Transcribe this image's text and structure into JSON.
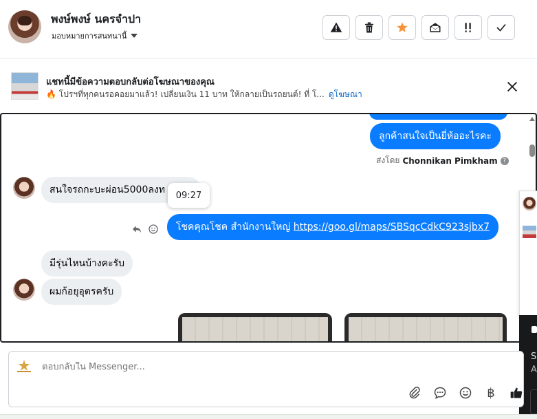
{
  "header": {
    "contact_name": "พงษ์พงษ์ นครจำปา",
    "assign_label": "มอบหมายการสนทนานี้",
    "actions": [
      {
        "name": "report-button",
        "icon": "warning-icon"
      },
      {
        "name": "delete-button",
        "icon": "trash-icon"
      },
      {
        "name": "star-button",
        "icon": "star-icon",
        "color": "#f7923a"
      },
      {
        "name": "mark-unread-button",
        "icon": "envelope-open-icon"
      },
      {
        "name": "follow-up-button",
        "icon": "double-exclamation-icon"
      },
      {
        "name": "mark-done-button",
        "icon": "check-icon"
      }
    ]
  },
  "ad_banner": {
    "title": "แชทนี้มีข้อความตอบกลับต่อโฆษณาของคุณ",
    "subtitle": "🔥 โปรฯที่ทุกคนรอคอยมาแล้ว! เปลี่ยนเงิน 11 บาท ให้กลายเป็นรถยนต์! ที่ โ...",
    "link_text": "ดูโฆษณา"
  },
  "messages": {
    "out_1": "ลูกค้าสนใจเป็นยี่ห้ออะไรคะ",
    "sent_by_prefix": "ส่งโดย",
    "sent_by_name": "Chonnikan Pimkham",
    "in_1": "สนใจรถกะบะผ่อน5000ลงท",
    "timestamp_tooltip": "09:27",
    "out_2_text": "โชคคุณโชค สำนักงานใหญ่ ",
    "out_2_link": "https://goo.gl/maps/SBSqcCdkC923sjbx7",
    "in_2": "มีรุ่นไหนบ้างคะรับ",
    "in_3": "ผมก้อยุอุตรครับ"
  },
  "side_panel": {
    "text_1": "Se",
    "text_2": "A"
  },
  "composer": {
    "placeholder": "ตอบกลับใน Messenger...",
    "currency_symbol": "฿"
  },
  "colors": {
    "outgoing_bubble": "#0a7cff",
    "incoming_bubble": "#eceff2",
    "star_accent": "#f7923a",
    "link": "#0a66c2"
  }
}
